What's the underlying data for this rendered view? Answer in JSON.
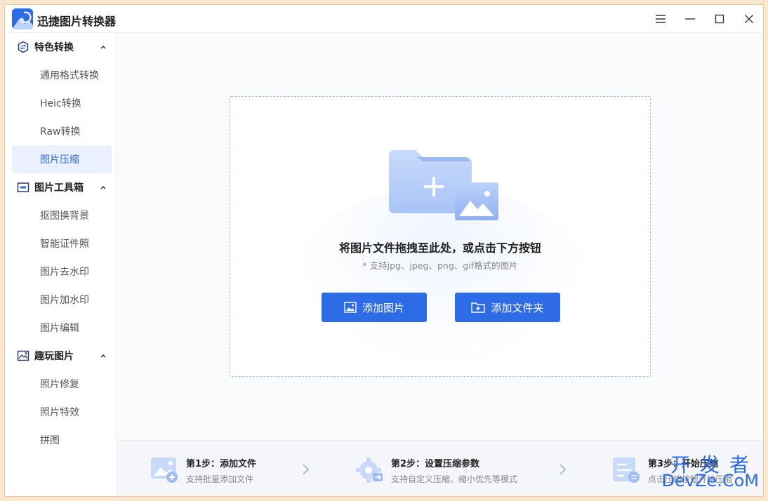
{
  "app": {
    "title": "迅捷图片转换器"
  },
  "colors": {
    "accent": "#2e6be6",
    "active_bg": "#eaf1fd",
    "window_border": "#f0c79a"
  },
  "window_controls": [
    "menu-icon",
    "minimize-icon",
    "maximize-icon",
    "close-icon"
  ],
  "sidebar": {
    "groups": [
      {
        "label": "特色转换",
        "icon": "convert-icon",
        "expanded": true,
        "items": [
          "通用格式转换",
          "Heic转换",
          "Raw转换",
          "图片压缩"
        ]
      },
      {
        "label": "图片工具箱",
        "icon": "toolbox-icon",
        "expanded": true,
        "items": [
          "抠图换背景",
          "智能证件照",
          "图片去水印",
          "图片加水印",
          "图片编辑"
        ]
      },
      {
        "label": "趣玩图片",
        "icon": "fun-image-icon",
        "expanded": true,
        "items": [
          "照片修复",
          "照片特效",
          "拼图"
        ]
      }
    ],
    "active_item": "图片压缩"
  },
  "dropzone": {
    "title": "将图片文件拖拽至此处，或点击下方按钮",
    "subtitle": "* 支持jpg、jpeg、png、gif格式的图片",
    "add_image_label": "添加图片",
    "add_folder_label": "添加文件夹"
  },
  "steps": [
    {
      "title": "第1步：添加文件",
      "desc": "支持批量添加文件"
    },
    {
      "title": "第2步：设置压缩参数",
      "desc": "支持自定义压缩、缩小优先等模式"
    },
    {
      "title": "第3步：开始压缩",
      "desc": "点击压缩按钮开始压缩"
    }
  ],
  "watermark": {
    "top": "开发者",
    "bottom": "DevZe.CoM"
  }
}
